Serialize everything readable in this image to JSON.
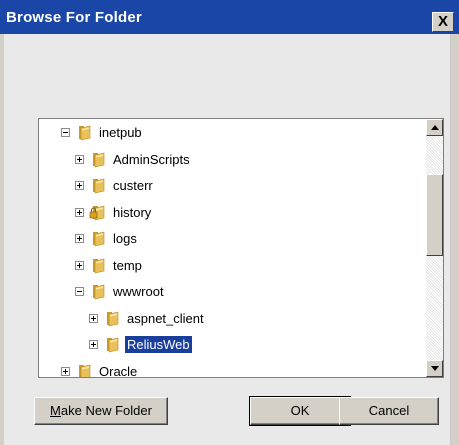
{
  "window": {
    "title": "Browse For Folder",
    "close_glyph": "X"
  },
  "tree": {
    "items": [
      {
        "label": "inetpub",
        "state": "expanded",
        "level": 0,
        "icon": "folder-icon",
        "selected": false
      },
      {
        "label": "AdminScripts",
        "state": "collapsed",
        "level": 1,
        "icon": "folder-icon",
        "selected": false
      },
      {
        "label": "custerr",
        "state": "collapsed",
        "level": 1,
        "icon": "folder-icon",
        "selected": false
      },
      {
        "label": "history",
        "state": "collapsed",
        "level": 1,
        "icon": "locked-folder-icon",
        "selected": false
      },
      {
        "label": "logs",
        "state": "collapsed",
        "level": 1,
        "icon": "folder-icon",
        "selected": false
      },
      {
        "label": "temp",
        "state": "collapsed",
        "level": 1,
        "icon": "folder-icon",
        "selected": false
      },
      {
        "label": "wwwroot",
        "state": "expanded",
        "level": 1,
        "icon": "folder-icon",
        "selected": false
      },
      {
        "label": "aspnet_client",
        "state": "collapsed",
        "level": 2,
        "icon": "folder-icon",
        "selected": false
      },
      {
        "label": "ReliusWeb",
        "state": "collapsed",
        "level": 2,
        "icon": "folder-icon",
        "selected": true
      },
      {
        "label": "Oracle",
        "state": "collapsed",
        "level": 0,
        "icon": "folder-icon",
        "selected": false
      }
    ]
  },
  "buttons": {
    "make_new_folder_mnemonic": "M",
    "make_new_folder_rest": "ake New Folder",
    "ok": "OK",
    "cancel": "Cancel"
  },
  "colors": {
    "titlebar": "#1a46a8",
    "selection": "#1a3e9c",
    "folder": "#e8c15a"
  }
}
